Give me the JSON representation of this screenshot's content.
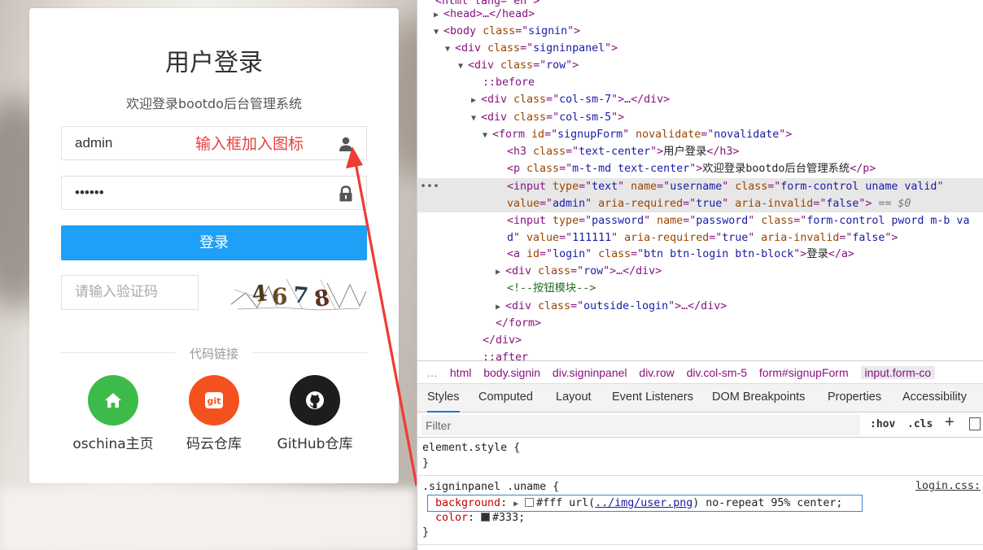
{
  "login": {
    "title": "用户登录",
    "subtitle": "欢迎登录bootdo后台管理系统",
    "username_value": "admin",
    "password_value": "••••••",
    "annotation": "输入框加入图标",
    "login_button": "登录",
    "captcha_placeholder": "请输入验证码",
    "captcha_text": "4678",
    "divider_text": "代码链接",
    "links": [
      {
        "label": "oschina主页",
        "icon": "home-icon",
        "color": "#3dbb4a"
      },
      {
        "label": "码云仓库",
        "icon": "git-icon",
        "color": "#f5511e"
      },
      {
        "label": "GitHub仓库",
        "icon": "github-icon",
        "color": "#1d1d1d"
      }
    ],
    "accent": "#1ea0f7",
    "annotation_color": "#e8403a"
  },
  "devtools": {
    "dom_lines": {
      "l0": "<html lang=\"en\">",
      "head": "<head>…</head>",
      "body_tag": "body",
      "body_attr": "class",
      "body_val": "signin",
      "div_signinpanel": "signinpanel",
      "div_row": "row",
      "before": "::before",
      "col7": "col-sm-7",
      "col5": "col-sm-5",
      "form_id": "signupForm",
      "form_novalidate": "novalidate",
      "h3_class": "text-center",
      "h3_text": "用户登录",
      "p_class": "m-t-md text-center",
      "p_text": "欢迎登录bootdo后台管理系统",
      "input1_type": "text",
      "input1_name": "username",
      "input1_class": "form-control uname valid",
      "input1_value": "admin",
      "input1_required": "true",
      "input1_invalid": "false",
      "input1_eq": "== $0",
      "input2_type": "password",
      "input2_name": "password",
      "input2_class": "form-control pword m-b va",
      "input2_class_cont": "d",
      "input2_value": "111111",
      "input2_required": "true",
      "input2_invalid": "false",
      "a_id": "login",
      "a_class": "btn btn-login btn-block",
      "a_text": "登录",
      "div_row2": "row",
      "comment": "<!--按钮模块-->",
      "outside": "outside-login",
      "form_close": "</form>",
      "div_close": "</div>",
      "after": "::after"
    },
    "breadcrumbs": [
      "html",
      "body.signin",
      "div.signinpanel",
      "div.row",
      "div.col-sm-5",
      "form#signupForm",
      "input.form-co"
    ],
    "breadcrumb_more": "…",
    "tabs": [
      "Styles",
      "Computed",
      "Layout",
      "Event Listeners",
      "DOM Breakpoints",
      "Properties",
      "Accessibility"
    ],
    "filter_placeholder": "Filter",
    "hov": ":hov",
    "cls": ".cls",
    "plus": "+",
    "styles": {
      "element_style": "element.style {",
      "close": "}",
      "selector": ".signinpanel .uname {",
      "source": "login.css:",
      "bg_prop": "background",
      "bg_val_pre": "#fff url(",
      "bg_link": "../img/user.png",
      "bg_val_post": ") no-repeat 95% center;",
      "color_prop": "color",
      "color_val": "#333;"
    }
  }
}
